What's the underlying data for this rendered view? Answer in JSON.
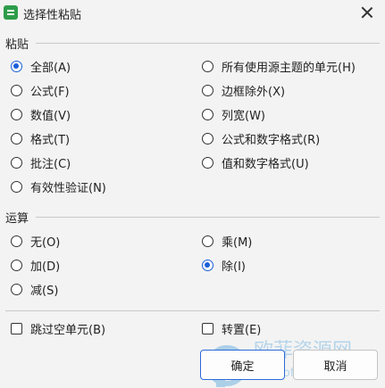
{
  "dialog": {
    "title": "选择性粘贴"
  },
  "paste": {
    "label": "粘贴",
    "options": [
      {
        "label": "全部(A)",
        "checked": true
      },
      {
        "label": "公式(F)",
        "checked": false
      },
      {
        "label": "数值(V)",
        "checked": false
      },
      {
        "label": "格式(T)",
        "checked": false
      },
      {
        "label": "批注(C)",
        "checked": false
      },
      {
        "label": "有效性验证(N)",
        "checked": false
      },
      {
        "label": "所有使用源主题的单元(H)",
        "checked": false
      },
      {
        "label": "边框除外(X)",
        "checked": false
      },
      {
        "label": "列宽(W)",
        "checked": false
      },
      {
        "label": "公式和数字格式(R)",
        "checked": false
      },
      {
        "label": "值和数字格式(U)",
        "checked": false
      }
    ]
  },
  "operation": {
    "label": "运算",
    "options": [
      {
        "label": "无(O)",
        "checked": false
      },
      {
        "label": "加(D)",
        "checked": false
      },
      {
        "label": "减(S)",
        "checked": false
      },
      {
        "label": "乘(M)",
        "checked": false
      },
      {
        "label": "除(I)",
        "checked": true
      }
    ]
  },
  "checkboxes": [
    {
      "label": "跳过空单元(B)",
      "checked": false
    },
    {
      "label": "转置(E)",
      "checked": false
    }
  ],
  "buttons": {
    "ok": "确定",
    "cancel": "取消"
  },
  "watermark": "欧菲资源网 www.office26.com",
  "colors": {
    "accent": "#1a5fd8",
    "app_icon": "#2e9d4a",
    "background": "#f3f3f3"
  },
  "icons": {
    "app": "wps-spreadsheet-icon",
    "close": "close-icon"
  }
}
